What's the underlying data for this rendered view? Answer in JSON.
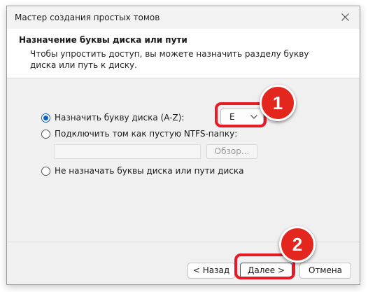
{
  "window": {
    "title": "Мастер создания простых томов"
  },
  "header": {
    "title": "Назначение буквы диска или пути",
    "subtitle": "Чтобы упростить доступ, вы можете назначить разделу букву диска или путь к диску."
  },
  "options": {
    "assign_letter": "Назначить букву диска (A-Z):",
    "mount_folder": "Подключить том как пустую NTFS-папку:",
    "no_letter": "Не назначать буквы диска или пути диска"
  },
  "drive_letter": {
    "value": "E"
  },
  "browse_button": "Обзор...",
  "buttons": {
    "back": "< Назад",
    "next": "Далее >",
    "cancel": "Отмена"
  },
  "annotations": {
    "badge1": "1",
    "badge2": "2"
  },
  "colors": {
    "highlight": "#e81a25",
    "accent": "#0a60c8"
  }
}
